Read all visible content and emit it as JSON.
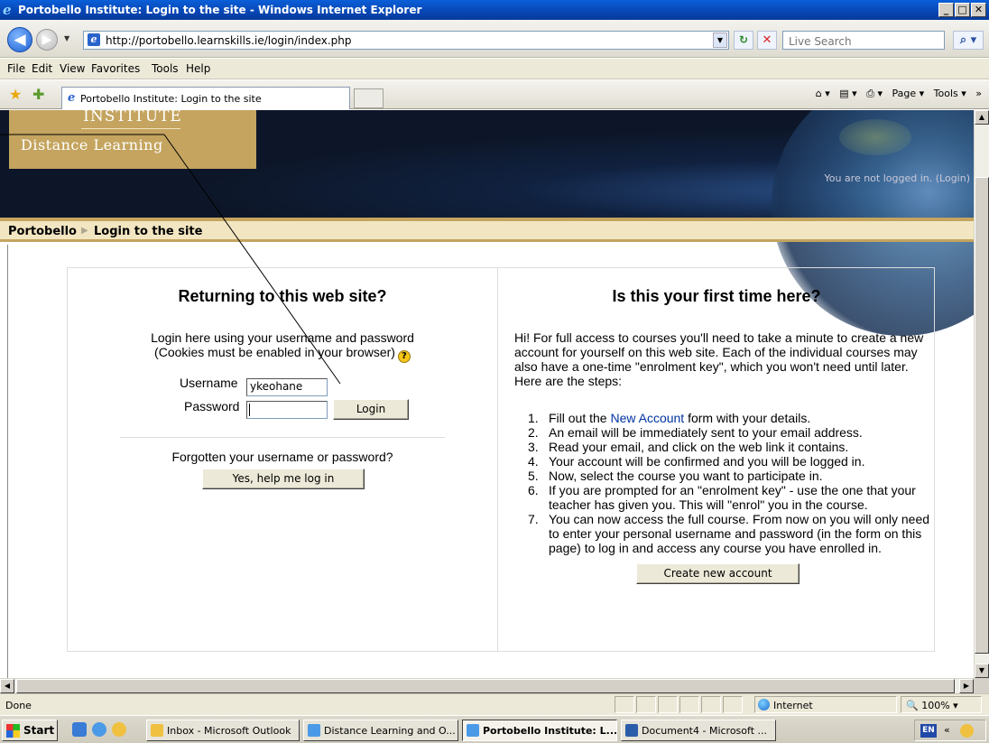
{
  "window": {
    "title": "Portobello Institute: Login to the site - Windows Internet Explorer",
    "minimize": "_",
    "maximize": "□",
    "close": "✕"
  },
  "address": {
    "url": "http://portobello.learnskills.ie/login/index.php",
    "search_placeholder": "Live Search"
  },
  "menu": [
    "File",
    "Edit",
    "View",
    "Favorites",
    "Tools",
    "Help"
  ],
  "tab": {
    "title": "Portobello Institute: Login to the site"
  },
  "command_bar": {
    "page": "Page ▾",
    "tools": "Tools ▾"
  },
  "header": {
    "logo_top": "INSTITUTE",
    "logo_bottom": "Distance Learning",
    "login_status": "You are not logged in. (Login)"
  },
  "breadcrumb": {
    "home": "Portobello",
    "separator": "▶",
    "current": "Login to the site"
  },
  "login": {
    "heading": "Returning to this web site?",
    "intro_line1": "Login here using your username and password",
    "intro_line2": "(Cookies must be enabled in your browser)",
    "username_label": "Username",
    "username_value": "ykeohane",
    "password_label": "Password",
    "login_button": "Login",
    "forgot_text": "Forgotten your username or password?",
    "help_button": "Yes, help me log in"
  },
  "signup": {
    "heading": "Is this your first time here?",
    "intro": "Hi! For full access to courses you'll need to take a minute to create a new account for yourself on this web site. Each of the individual courses may also have a one-time \"enrolment key\", which you won't need until later. Here are the steps:",
    "steps": [
      {
        "n": "1.",
        "before": "Fill out the ",
        "link": "New Account",
        "after": " form with your details."
      },
      {
        "n": "2.",
        "before": "An email will be immediately sent to your email address.",
        "link": "",
        "after": ""
      },
      {
        "n": "3.",
        "before": "Read your email, and click on the web link it contains.",
        "link": "",
        "after": ""
      },
      {
        "n": "4.",
        "before": "Your account will be confirmed and you will be logged in.",
        "link": "",
        "after": ""
      },
      {
        "n": "5.",
        "before": "Now, select the course you want to participate in.",
        "link": "",
        "after": ""
      },
      {
        "n": "6.",
        "before": "If you are prompted for an \"enrolment key\" - use the one that your teacher has given you. This will \"enrol\" you in the course.",
        "link": "",
        "after": ""
      },
      {
        "n": "7.",
        "before": "You can now access the full course. From now on you will only need to enter your personal username and password (in the form on this page) to log in and access any course you have enrolled in.",
        "link": "",
        "after": ""
      }
    ],
    "create_button": "Create new account"
  },
  "status": {
    "text": "Done",
    "zone": "Internet",
    "zoom": "100%"
  },
  "taskbar": {
    "start": "Start",
    "tasks": [
      {
        "label": "Inbox - Microsoft Outlook",
        "active": false
      },
      {
        "label": "Distance Learning and O...",
        "active": false
      },
      {
        "label": "Portobello Institute: L...",
        "active": true
      },
      {
        "label": "Document4 - Microsoft ...",
        "active": false
      }
    ],
    "lang": "EN"
  },
  "colors": {
    "accent_gold": "#c4a45f",
    "banner_navy": "#0d1628",
    "link_blue": "#0033a0"
  }
}
